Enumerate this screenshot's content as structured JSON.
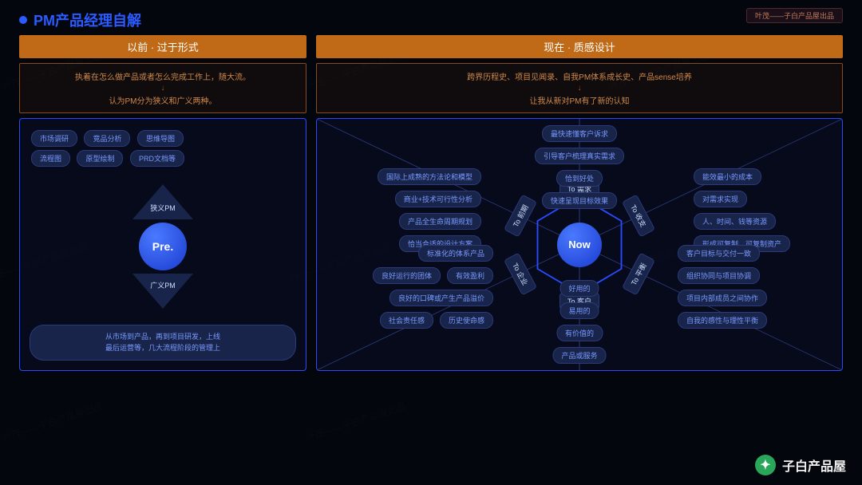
{
  "title": "PM产品经理自解",
  "badge": "叶茂——子白产品屋出品",
  "left": {
    "header": "以前 · 过于形式",
    "intro1": "执着在怎么做产品或者怎么完成工作上，随大流。",
    "intro2": "认为PM分为狭义和广义两种。",
    "tags": [
      "市场调研",
      "竞品分析",
      "思维导图",
      "流程图",
      "原型绘制",
      "PRD文档等"
    ],
    "topLabel": "狭义PM",
    "circle": "Pre.",
    "botLabel": "广义PM",
    "bottom": "从市场到产品，再到项目研发，上线\n最后运营等，几大流程阶段的管理上"
  },
  "right": {
    "header": "现在 · 质感设计",
    "intro1": "跨界历程史、项目见闻录、自我PM体系成长史、产品sense培养",
    "intro2": "让我从新对PM有了新的认知",
    "center": "Now",
    "edges": [
      "To 需求",
      "To 收支",
      "To 平衡",
      "To 客户",
      "To 企业",
      "To 前期"
    ],
    "g0": [
      "国际上成熟的方法论和模型",
      "商业+技术可行性分析",
      "产品全生命周期规划",
      "恰当合适的设计方案"
    ],
    "g1": [
      "最快速懂客户诉求",
      "引导客户梳理真实需求",
      "恰到好处",
      "快速呈现目标效果"
    ],
    "g2": [
      "能效最小的成本",
      "对需求实现",
      "人、时间、钱等资源",
      "形成可复制、可复制资产"
    ],
    "g3": [
      "客户目标与交付一致",
      "组织协同与项目协调",
      "项目内部成员之间协作",
      "自我的感性与理性平衡"
    ],
    "g4": [
      "好用的",
      "易用的",
      "有价值的",
      "产品或服务"
    ],
    "g5a": [
      "标准化的体系产品"
    ],
    "g5b": [
      [
        "良好运行的团体",
        "有效盈利"
      ],
      [
        "良好的口碑或产生产品溢价"
      ],
      [
        "社会责任感",
        "历史使命感"
      ]
    ]
  },
  "signature": "子白产品屋"
}
